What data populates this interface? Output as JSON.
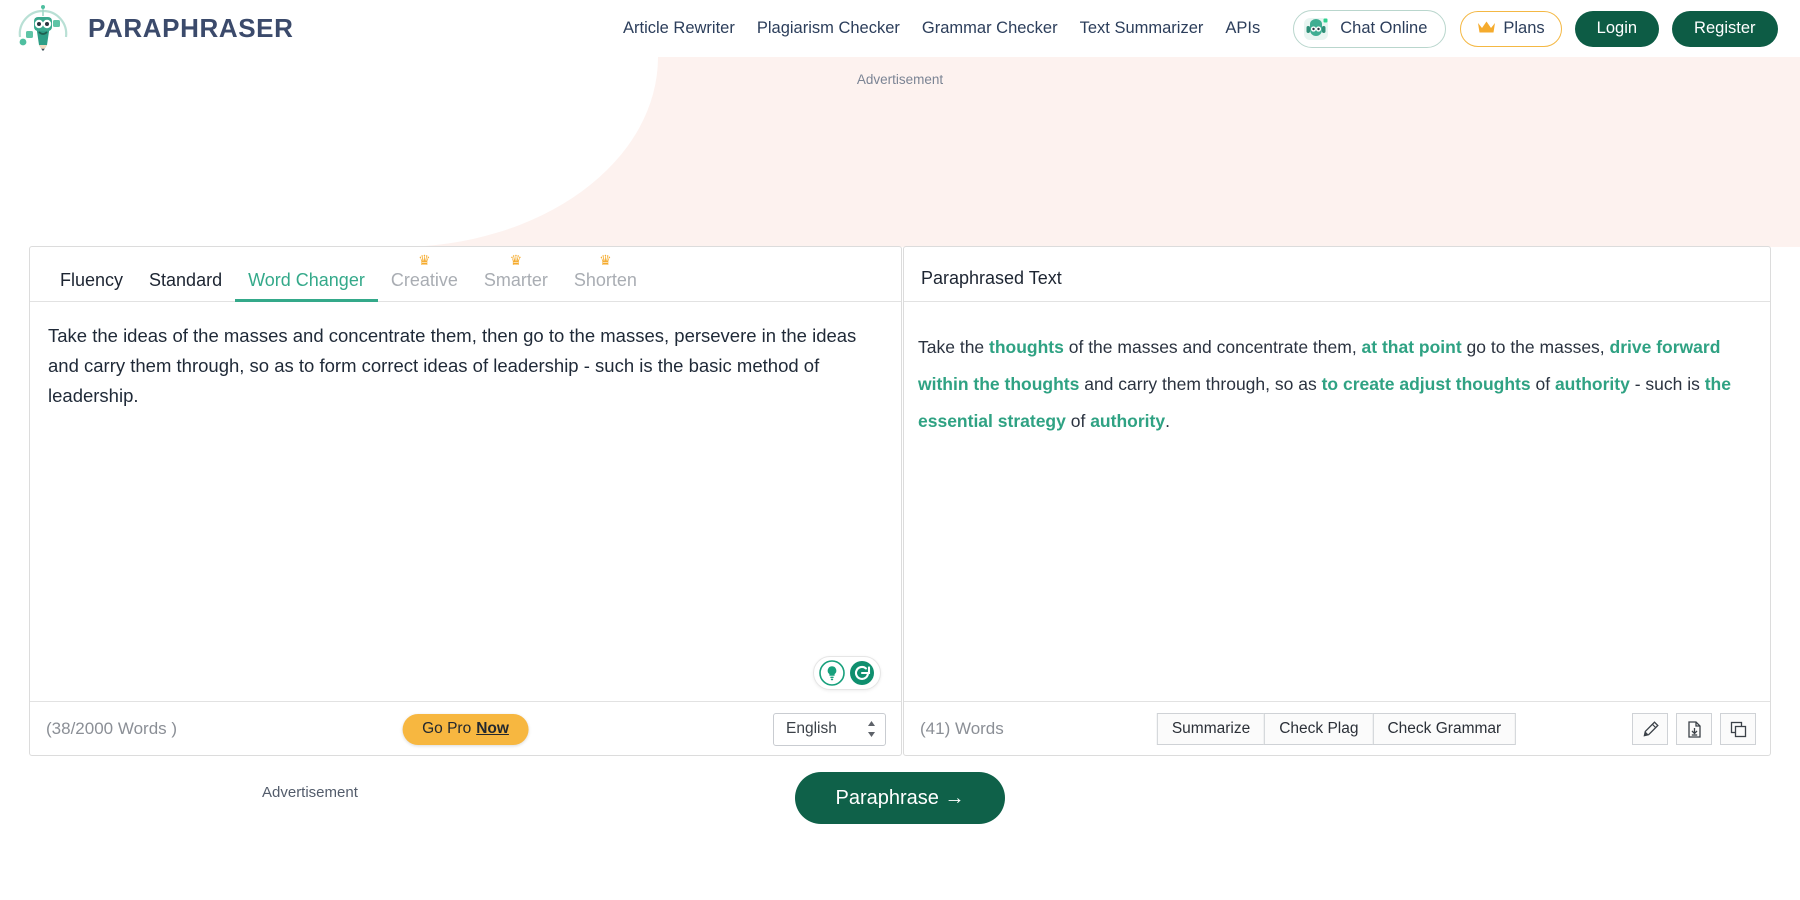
{
  "brand": {
    "title": "PARAPHRASER",
    "logo_icon": "robot-pencil-logo"
  },
  "nav": {
    "links": [
      {
        "label": "Article Rewriter"
      },
      {
        "label": "Plagiarism Checker"
      },
      {
        "label": "Grammar Checker"
      },
      {
        "label": "Text Summarizer"
      },
      {
        "label": "APIs"
      }
    ],
    "chat": {
      "label": "Chat Online",
      "icon": "chat-bot-avatar-icon"
    },
    "plans": {
      "label": "Plans",
      "icon": "crown-icon"
    },
    "login": {
      "label": "Login"
    },
    "register": {
      "label": "Register"
    }
  },
  "ads": {
    "top_label": "Advertisement",
    "bottom_label": "Advertisement"
  },
  "editor": {
    "tabs": [
      {
        "label": "Fluency",
        "state": "normal",
        "crown": false
      },
      {
        "label": "Standard",
        "state": "normal",
        "crown": false
      },
      {
        "label": "Word Changer",
        "state": "active",
        "crown": false
      },
      {
        "label": "Creative",
        "state": "locked",
        "crown": true
      },
      {
        "label": "Smarter",
        "state": "locked",
        "crown": true
      },
      {
        "label": "Shorten",
        "state": "locked",
        "crown": true
      }
    ],
    "input_text": "Take the ideas of the masses and concentrate them, then go to the masses, persevere in the ideas and carry them through, so as to form correct ideas of leadership - such is the basic method of leadership.",
    "word_count": "(38/2000 Words )",
    "go_pro": {
      "prefix": "Go Pro",
      "emphasis": "Now"
    },
    "language": {
      "value": "English",
      "icon": "stepper-chevrons-icon"
    },
    "helper_icons": [
      {
        "name": "lightbulb-icon"
      },
      {
        "name": "refresh-icon"
      }
    ]
  },
  "output": {
    "title": "Paraphrased Text",
    "word_count": "(41) Words",
    "buttons": [
      {
        "label": "Summarize"
      },
      {
        "label": "Check Plag"
      },
      {
        "label": "Check Grammar"
      }
    ],
    "icon_buttons": [
      {
        "name": "highlighter-pen-icon"
      },
      {
        "name": "download-document-icon"
      },
      {
        "name": "copy-icon"
      }
    ],
    "segments": [
      {
        "text": "Take the ",
        "highlight": false
      },
      {
        "text": "thoughts",
        "highlight": true
      },
      {
        "text": " of the masses and concentrate them, ",
        "highlight": false
      },
      {
        "text": "at that point",
        "highlight": true
      },
      {
        "text": " go to the masses, ",
        "highlight": false
      },
      {
        "text": "drive forward within the thoughts",
        "highlight": true
      },
      {
        "text": " and carry them through, so as ",
        "highlight": false
      },
      {
        "text": "to create adjust thoughts",
        "highlight": true
      },
      {
        "text": " of ",
        "highlight": false
      },
      {
        "text": "authority",
        "highlight": true
      },
      {
        "text": " - such is ",
        "highlight": false
      },
      {
        "text": "the essential strategy",
        "highlight": true
      },
      {
        "text": " of ",
        "highlight": false
      },
      {
        "text": "authority",
        "highlight": true
      },
      {
        "text": ".",
        "highlight": false
      }
    ]
  },
  "action": {
    "paraphrase_label": "Paraphrase →"
  },
  "colors": {
    "brand_navy": "#3b4a6b",
    "accent_green": "#34a98a",
    "dark_green": "#0d5c45",
    "gold": "#f5ab2d",
    "pink_bg": "#fdf2ef"
  }
}
